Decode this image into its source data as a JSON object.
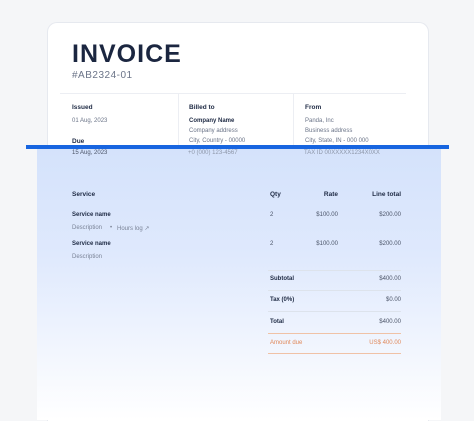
{
  "invoice": {
    "title": "INVOICE",
    "number": "#AB2324-01"
  },
  "issued": {
    "label": "Issued",
    "date": "01 Aug, 2023"
  },
  "due": {
    "label": "Due",
    "date": "15 Aug, 2023"
  },
  "billed_to": {
    "label": "Billed to",
    "name": "Company Name",
    "address": "Company address",
    "city": "City, Country - 00000",
    "phone": "+0 (000) 123-4567"
  },
  "from": {
    "label": "From",
    "name": "Panda, Inc",
    "address": "Business address",
    "city": "City, State, IN - 000 000",
    "tax": "TAX ID 00XXXXX1234X0XX"
  },
  "table": {
    "headers": {
      "service": "Service",
      "qty": "Qty",
      "rate": "Rate",
      "total": "Line total"
    },
    "rows": [
      {
        "name": "Service name",
        "desc": "Description",
        "extra": "Hours log ↗",
        "qty": "2",
        "rate": "$100.00",
        "total": "$200.00"
      },
      {
        "name": "Service name",
        "desc": "Description",
        "qty": "2",
        "rate": "$100.00",
        "total": "$200.00"
      }
    ]
  },
  "summary": {
    "subtotal_label": "Subtotal",
    "subtotal": "$400.00",
    "tax_label": "Tax (0%)",
    "tax": "$0.00",
    "total_label": "Total",
    "total": "$400.00",
    "amount_due_label": "Amount due",
    "amount_due": "US$ 400.00"
  },
  "colors": {
    "accent_blue": "#1765e0",
    "amount_due": "#e0895a"
  }
}
